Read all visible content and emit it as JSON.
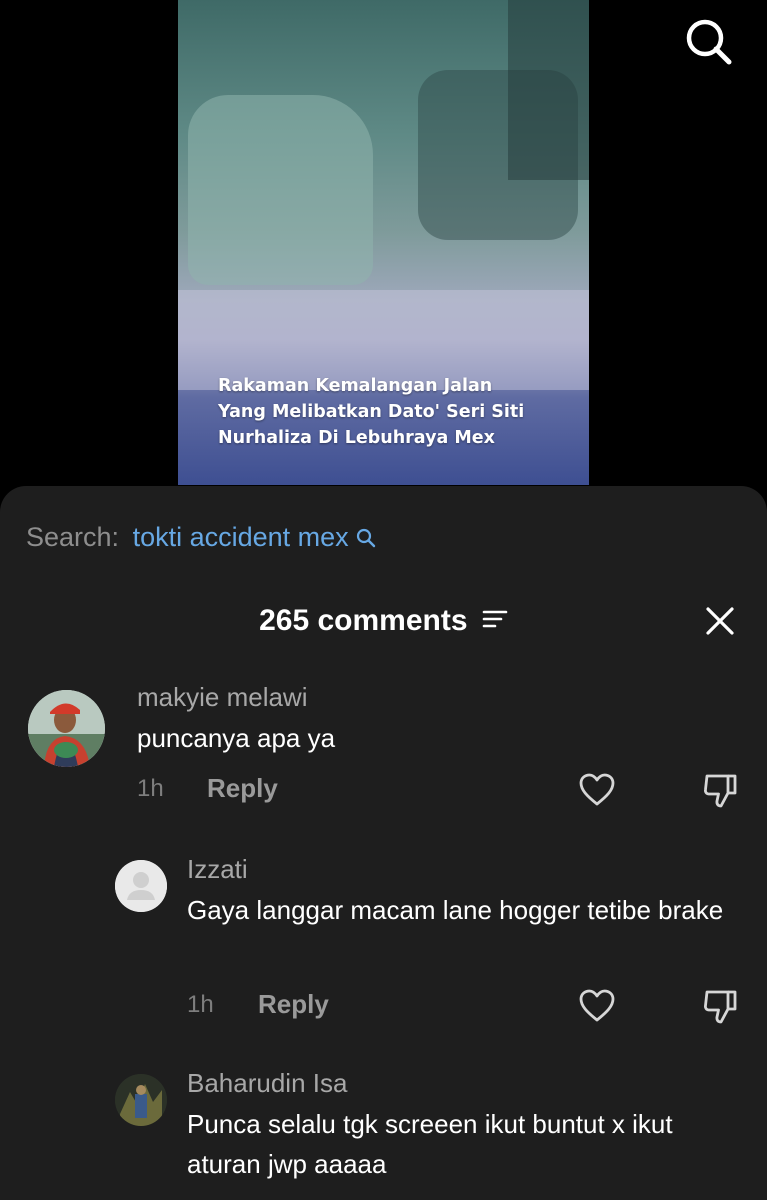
{
  "video": {
    "caption_lines": [
      "Rakaman Kemalangan Jalan",
      "Yang Melibatkan Dato' Seri Siti",
      "Nurhaliza Di Lebuhraya Mex"
    ],
    "top_icon": "search-icon"
  },
  "search": {
    "prefix": "Search:",
    "query": "tokti accident mex"
  },
  "comments_header": {
    "count_label": "265 comments"
  },
  "comments": [
    {
      "username": "makyie melawi",
      "text": "puncanya apa ya",
      "time": "1h",
      "reply_label": "Reply"
    },
    {
      "username": "Izzati",
      "text": "Gaya langgar macam lane hogger tetibe brake",
      "time": "1h",
      "reply_label": "Reply"
    },
    {
      "username": "Baharudin Isa",
      "text": "Punca selalu tgk screeen ikut buntut x ikut aturan jwp aaaaa"
    }
  ],
  "colors": {
    "sheet_bg": "#1e1e1e",
    "link_blue": "#67a8e4",
    "muted_text": "#a8a8a8"
  }
}
